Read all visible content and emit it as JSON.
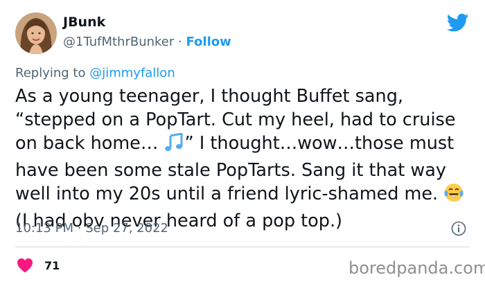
{
  "author": {
    "display_name": "JBunk",
    "handle": "@1TufMthrBunker",
    "separator": "·",
    "follow_label": "Follow"
  },
  "reply": {
    "prefix": "Replying to",
    "mention": "@jimmyfallon"
  },
  "tweet": {
    "lines": [
      "As a young teenager, I thought Buffet sang,",
      "“stepped on a PopTart. Cut my heel, had to cruise",
      "on back home…",
      "” I thought…wow…those must",
      "have been some stale PopTarts. Sang it that way",
      "well into my 20s until a friend lyric-shamed me.",
      " (I had obv never heard of a pop top.)"
    ]
  },
  "meta": {
    "time": "10:13 PM",
    "separator": "·",
    "date": "Sep 27, 2022"
  },
  "engagement": {
    "likes": "71"
  },
  "watermark": "boredpanda.com",
  "icons": {
    "brand": "twitter-bird-icon",
    "info": "info-icon",
    "like": "heart-icon",
    "emoji_music": "musical-notes-icon",
    "emoji_laugh": "tears-of-joy-icon"
  },
  "colors": {
    "accent": "#1d9bf0",
    "heart": "#f91880",
    "secondary_text": "#536471",
    "primary_text": "#0f1419"
  }
}
